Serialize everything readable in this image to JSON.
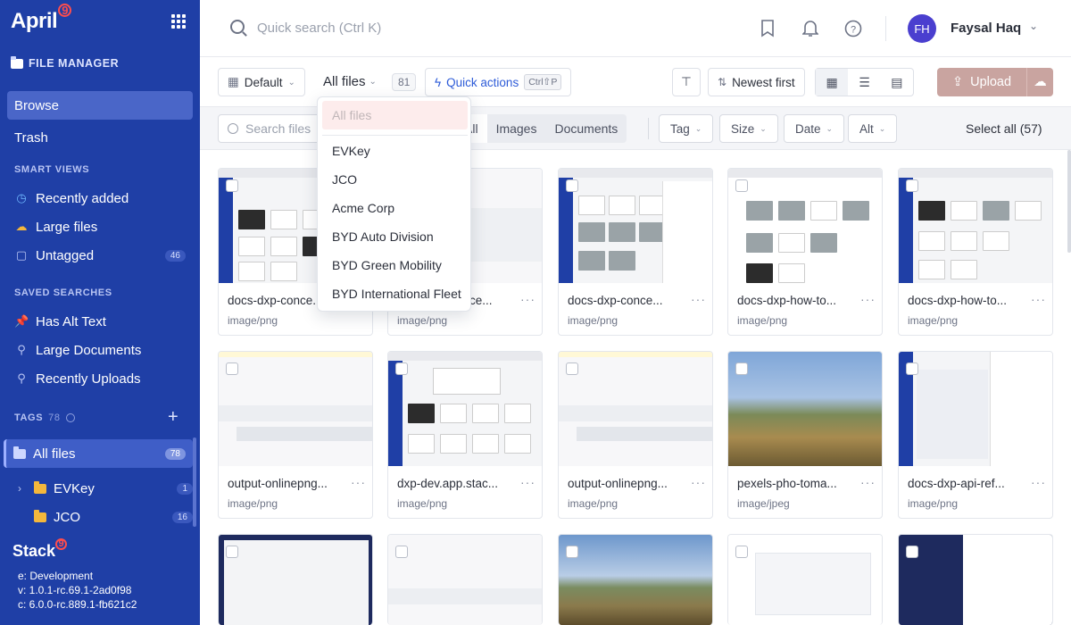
{
  "sidebar": {
    "logo": "April",
    "logo_mark": "9",
    "heading": "FILE MANAGER",
    "browse": "Browse",
    "trash": "Trash",
    "smart_views_title": "SMART VIEWS",
    "smart_views": [
      {
        "label": "Recently added",
        "icon": "clock-icon"
      },
      {
        "label": "Large files",
        "icon": "cloud-icon"
      },
      {
        "label": "Untagged",
        "icon": "lock-icon",
        "count": "46"
      }
    ],
    "saved_searches_title": "SAVED SEARCHES",
    "saved_searches": [
      {
        "label": "Has Alt Text",
        "icon": "pin-icon"
      },
      {
        "label": "Large Documents",
        "icon": "search-icon"
      },
      {
        "label": "Recently Uploads",
        "icon": "search-icon"
      }
    ],
    "tags_title": "TAGS",
    "tags_count": "78",
    "all_files": "All files",
    "all_files_count": "78",
    "tags": [
      {
        "label": "EVKey",
        "count": "1"
      },
      {
        "label": "JCO",
        "count": "16"
      }
    ],
    "stack_logo": "Stack",
    "stack_mark": "9",
    "env": "e: Development",
    "version_v": "v: 1.0.1-rc.69.1-2ad0f98",
    "version_c": "c: 6.0.0-rc.889.1-fb621c2"
  },
  "topbar": {
    "search_placeholder": "Quick search (Ctrl K)",
    "avatar_initials": "FH",
    "user_name": "Faysal Haq"
  },
  "toolbar": {
    "default_label": "Default",
    "all_files_label": "All files",
    "file_count": "81",
    "quick_actions": "Quick actions",
    "quick_actions_kbd": "Ctrl⇧P",
    "sort_label": "Newest first",
    "upload_label": "Upload"
  },
  "filters": {
    "search_placeholder": "Search files",
    "segments": [
      "All",
      "Images",
      "Documents"
    ],
    "buttons": [
      "Tag",
      "Size",
      "Date",
      "Alt"
    ],
    "select_all": "Select all (57)"
  },
  "dropdown": {
    "selected": "All files",
    "options": [
      "EVKey",
      "JCO",
      "Acme Corp",
      "BYD Auto Division",
      "BYD Green Mobility",
      "BYD International Fleet"
    ]
  },
  "files": [
    {
      "name": "docs-dxp-conce...",
      "type": "image/png"
    },
    {
      "name": "docs-dxp-conce...",
      "type": "image/png"
    },
    {
      "name": "docs-dxp-conce...",
      "type": "image/png"
    },
    {
      "name": "docs-dxp-how-to...",
      "type": "image/png"
    },
    {
      "name": "docs-dxp-how-to...",
      "type": "image/png"
    },
    {
      "name": "output-onlinepng...",
      "type": "image/png"
    },
    {
      "name": "dxp-dev.app.stac...",
      "type": "image/png"
    },
    {
      "name": "output-onlinepng...",
      "type": "image/png"
    },
    {
      "name": "pexels-pho-toma...",
      "type": "image/jpeg"
    },
    {
      "name": "docs-dxp-api-ref...",
      "type": "image/png"
    }
  ],
  "colors": {
    "sidebar": "#1f3fa6",
    "accent": "#2d5bd8",
    "upload": "#c9a4a0",
    "logo_mark": "#ff4d4d"
  }
}
